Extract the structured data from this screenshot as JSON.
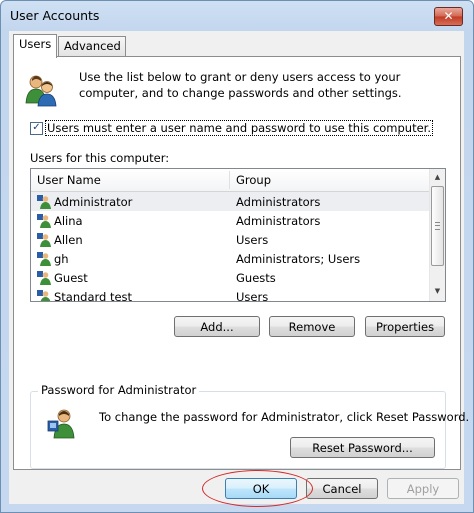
{
  "window": {
    "title": "User Accounts",
    "close_glyph": "✕"
  },
  "tabs": [
    {
      "label": "Users",
      "active": true
    },
    {
      "label": "Advanced",
      "active": false
    }
  ],
  "intro": {
    "icon": "users-icon",
    "text": "Use the list below to grant or deny users access to your computer, and to change passwords and other settings."
  },
  "require_login": {
    "checked": true,
    "label": "Users must enter a user name and password to use this computer."
  },
  "users_section": {
    "label": "Users for this computer:",
    "columns": [
      "User Name",
      "Group"
    ],
    "rows": [
      {
        "name": "Administrator",
        "group": "Administrators",
        "selected": true
      },
      {
        "name": "Alina",
        "group": "Administrators",
        "selected": false
      },
      {
        "name": "Allen",
        "group": "Users",
        "selected": false
      },
      {
        "name": "gh",
        "group": "Administrators; Users",
        "selected": false
      },
      {
        "name": "Guest",
        "group": "Guests",
        "selected": false
      },
      {
        "name": "Standard test",
        "group": "Users",
        "selected": false
      }
    ]
  },
  "list_buttons": {
    "add": "Add...",
    "remove": "Remove",
    "properties": "Properties"
  },
  "password_group": {
    "title": "Password for Administrator",
    "text": "To change the password for Administrator, click Reset Password.",
    "reset_button": "Reset Password..."
  },
  "footer": {
    "ok": "OK",
    "cancel": "Cancel",
    "apply": "Apply",
    "apply_enabled": false
  },
  "annotation": {
    "color": "#d42c2c"
  }
}
